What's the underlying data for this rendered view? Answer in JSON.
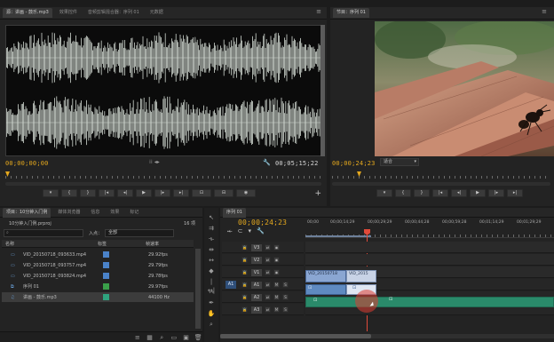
{
  "source_panel": {
    "tabs": [
      "源：讲画 - 鼓乐.mp3",
      "效果控件",
      "音频剪辑混合器：序列 01",
      "元数据"
    ],
    "timecode_in": "00;00;00;00",
    "timecode_dur": "00;05;15;22",
    "menu_icon": "menu-icon"
  },
  "program_panel": {
    "tabs": [
      "节目：序列 01"
    ],
    "timecode": "00;00;24;23",
    "fit_label": "适合"
  },
  "project_panel": {
    "tabs": [
      "项目：10分钟入门例",
      "媒体浏览器",
      "信息",
      "效果",
      "标记"
    ],
    "project_file": "10分钟入门例.prproj",
    "item_count": "16 项",
    "search_placeholder": "",
    "entry_label": "入点：",
    "entry_value": "全部",
    "columns": [
      "名称",
      "标签",
      "帧速率"
    ],
    "items": [
      {
        "name": "VID_20150718_093633.mp4",
        "label_color": "#4a82c8",
        "rate": "29.92fps",
        "icon": "video-clip-icon"
      },
      {
        "name": "VID_20150718_093757.mp4",
        "label_color": "#4a82c8",
        "rate": "29.79fps",
        "icon": "video-clip-icon"
      },
      {
        "name": "VID_20150718_093824.mp4",
        "label_color": "#4a82c8",
        "rate": "29.78fps",
        "icon": "video-clip-icon"
      },
      {
        "name": "序列 01",
        "label_color": "#3aa04a",
        "rate": "29.97fps",
        "icon": "sequence-icon"
      },
      {
        "name": "讲画 - 鼓乐.mp3",
        "label_color": "#2fa37e",
        "rate": "44100 Hz",
        "icon": "audio-clip-icon"
      }
    ]
  },
  "timeline": {
    "tab": "序列 01",
    "timecode": "00;00;24;23",
    "ruler_marks": [
      "00;00",
      "00;00;14;29",
      "00;00;29;29",
      "00;00;44;28",
      "00;00;59;28",
      "00;01;14;29",
      "00;01;29;29"
    ],
    "video_tracks": [
      "V3",
      "V2",
      "V1"
    ],
    "audio_tracks": [
      "A1",
      "A2",
      "A3"
    ],
    "source_patch": "A1",
    "clip_v1_a": "VID_20150718",
    "clip_v1_b": "VID_2015",
    "toggle_m": "M",
    "toggle_s": "S",
    "accent_playhead": "#e04a3a",
    "accent_audio_clip": "#2a8a6a",
    "accent_video_clip": "#5f8ac0"
  },
  "transport": {
    "source_buttons": [
      "marker",
      "in",
      "out",
      "go-in",
      "step-back",
      "play",
      "step-fwd",
      "go-out",
      "insert",
      "overwrite",
      "export"
    ],
    "add_label": "+"
  }
}
